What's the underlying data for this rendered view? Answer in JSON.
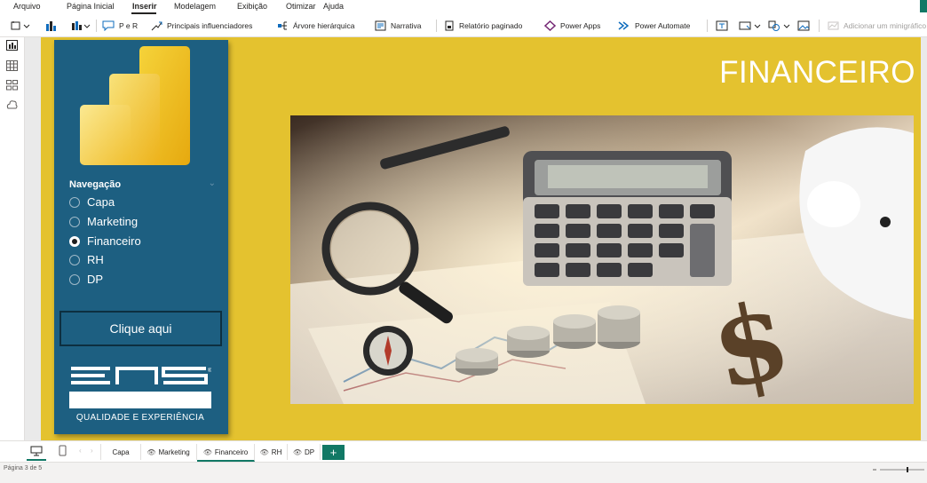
{
  "menu": {
    "items": [
      {
        "label": "Arquivo",
        "active": false
      },
      {
        "label": "Página Inicial",
        "active": false
      },
      {
        "label": "Inserir",
        "active": true
      },
      {
        "label": "Modelagem",
        "active": false
      },
      {
        "label": "Exibição",
        "active": false
      },
      {
        "label": "Otimizar",
        "active": false
      },
      {
        "label": "Ajuda",
        "active": false
      }
    ]
  },
  "ribbon": {
    "qa": "P e R",
    "key_influencers": "Principais influenciadores",
    "decomposition_tree": "Árvore hierárquica",
    "narrative": "Narrativa",
    "paginated_report": "Relatório paginado",
    "power_apps": "Power Apps",
    "power_automate": "Power Automate",
    "add_sparkline": "Adicionar um minigráfico"
  },
  "report": {
    "title": "FINANCEIRO",
    "nav": {
      "heading": "Navegação",
      "options": [
        {
          "label": "Capa",
          "selected": false
        },
        {
          "label": "Marketing",
          "selected": false
        },
        {
          "label": "Financeiro",
          "selected": true
        },
        {
          "label": "RH",
          "selected": false
        },
        {
          "label": "DP",
          "selected": false
        }
      ],
      "button": "Clique aqui"
    },
    "brand": {
      "name": "ENS",
      "tagline": "QUALIDADE E EXPERIÊNCIA"
    }
  },
  "tabs": [
    {
      "label": "Capa",
      "hidden_icon": false,
      "active": false
    },
    {
      "label": "Marketing",
      "hidden_icon": true,
      "active": false
    },
    {
      "label": "Financeiro",
      "hidden_icon": true,
      "active": true
    },
    {
      "label": "RH",
      "hidden_icon": true,
      "active": false
    },
    {
      "label": "DP",
      "hidden_icon": true,
      "active": false
    }
  ],
  "add_tab": "+",
  "status": {
    "page_info": "Página 3 de 5"
  },
  "colors": {
    "accent": "#117865",
    "canvas": "#e4c22f",
    "nav_panel": "#1d5f81"
  }
}
